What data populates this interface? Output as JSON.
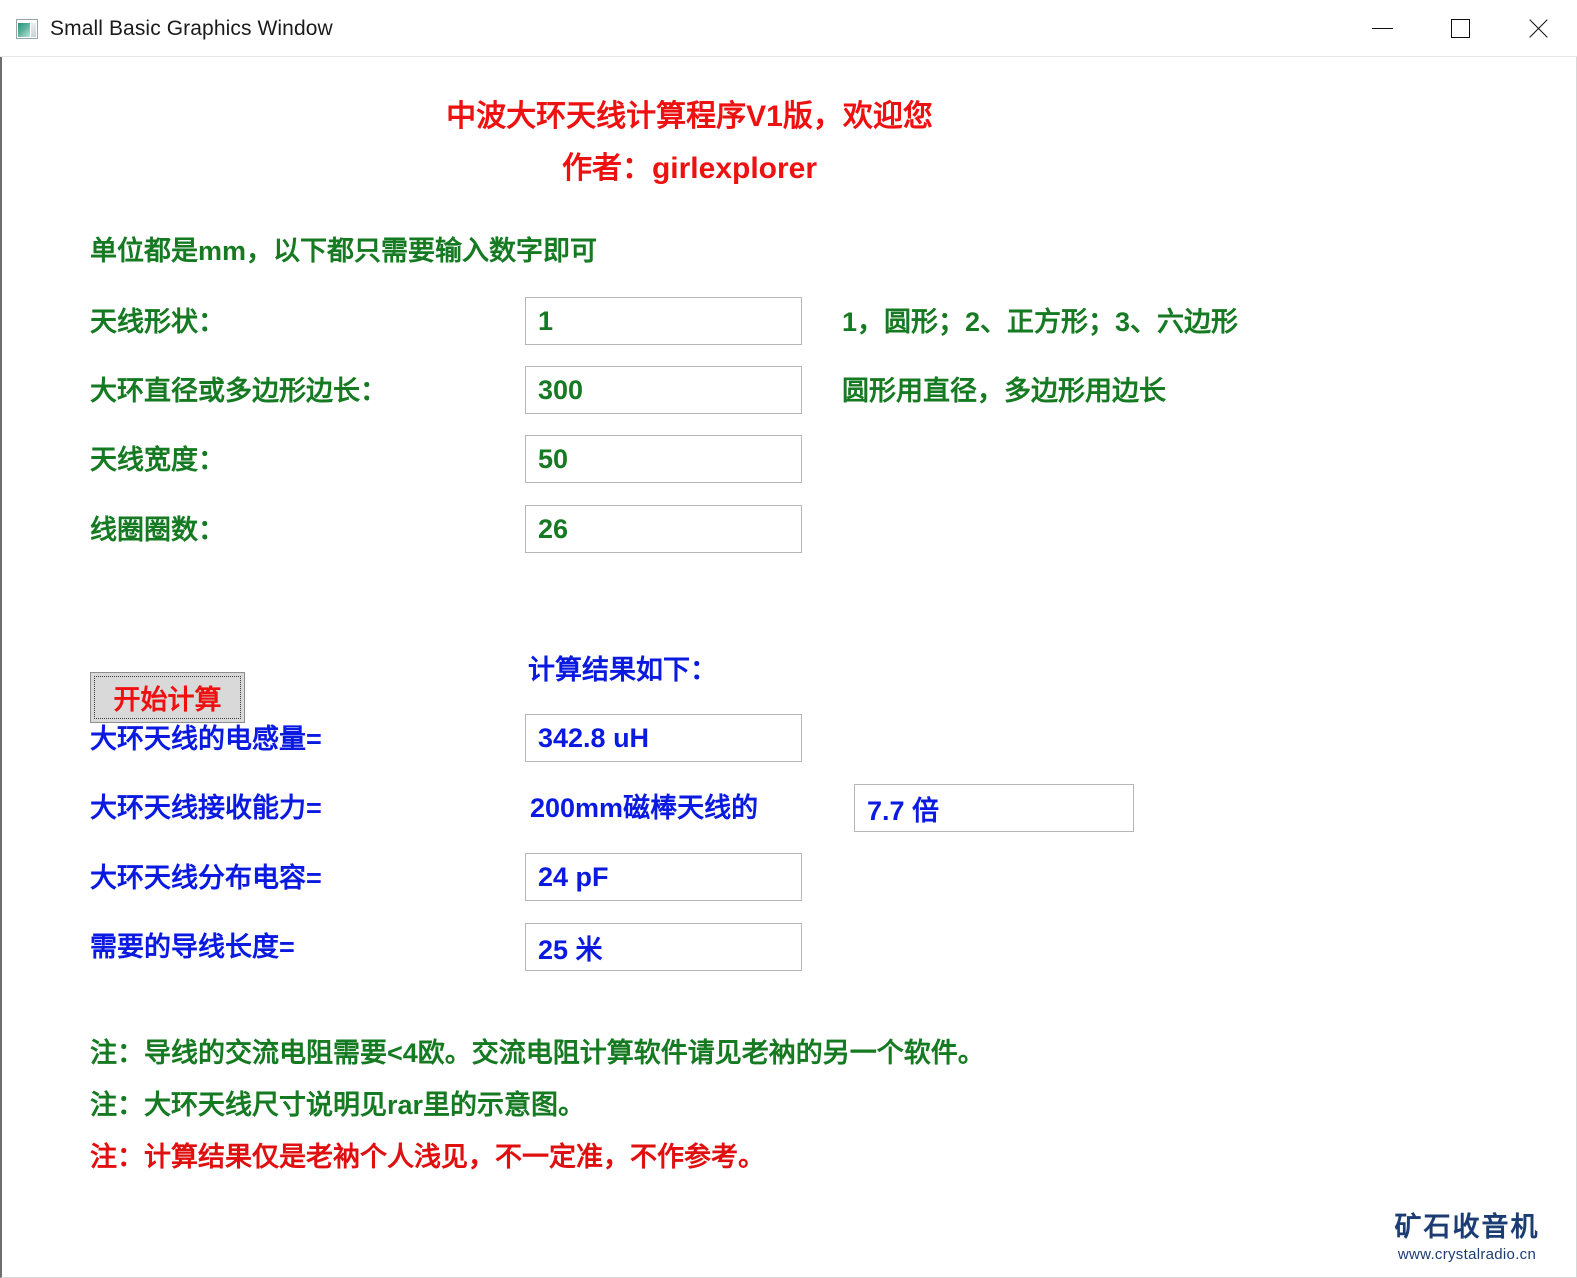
{
  "window": {
    "title": "Small Basic Graphics Window",
    "icon": "small-basic-window-icon",
    "minimize_label": "—",
    "maximize_label": "□",
    "close_label": "✕"
  },
  "header": {
    "line1": "中波大环天线计算程序V1版，欢迎您",
    "line2": "作者：girlexplorer",
    "color": "#ee1111"
  },
  "units_note": "单位都是mm，以下都只需要输入数字即可",
  "inputs": [
    {
      "label": "天线形状：",
      "value": "1",
      "hint": "1，圆形；2、正方形；3、六边形"
    },
    {
      "label": "大环直径或多边形边长：",
      "value": "300",
      "hint": "圆形用直径，多边形用边长"
    },
    {
      "label": "天线宽度：",
      "value": "50",
      "hint": ""
    },
    {
      "label": "线圈圈数：",
      "value": "26",
      "hint": ""
    }
  ],
  "action": {
    "calc_button_label": "开始计算",
    "results_title": "计算结果如下："
  },
  "results": [
    {
      "label": "大环天线的电感量=",
      "value": "342.8 uH"
    },
    {
      "label": "大环天线接收能力=",
      "prefix_text": "200mm磁棒天线的",
      "value": "7.7 倍"
    },
    {
      "label": "大环天线分布电容=",
      "value": "24 pF"
    },
    {
      "label": "需要的导线长度=",
      "value": "25 米"
    }
  ],
  "notes": [
    {
      "text": "注：导线的交流电阻需要<4欧。交流电阻计算软件请见老衲的另一个软件。",
      "color": "#167a22"
    },
    {
      "text": "注：大环天线尺寸说明见rar里的示意图。",
      "color": "#167a22"
    },
    {
      "text": "注：计算结果仅是老衲个人浅见，不一定准，不作参考。",
      "color": "#e01010"
    }
  ],
  "watermark": {
    "name": "矿石收音机",
    "url": "www.crystalradio.cn",
    "color": "#1c3d73"
  },
  "colors": {
    "green": "#167a22",
    "blue": "#0a1ae0",
    "red": "#ee1111",
    "field_border": "#b6b6b6"
  }
}
